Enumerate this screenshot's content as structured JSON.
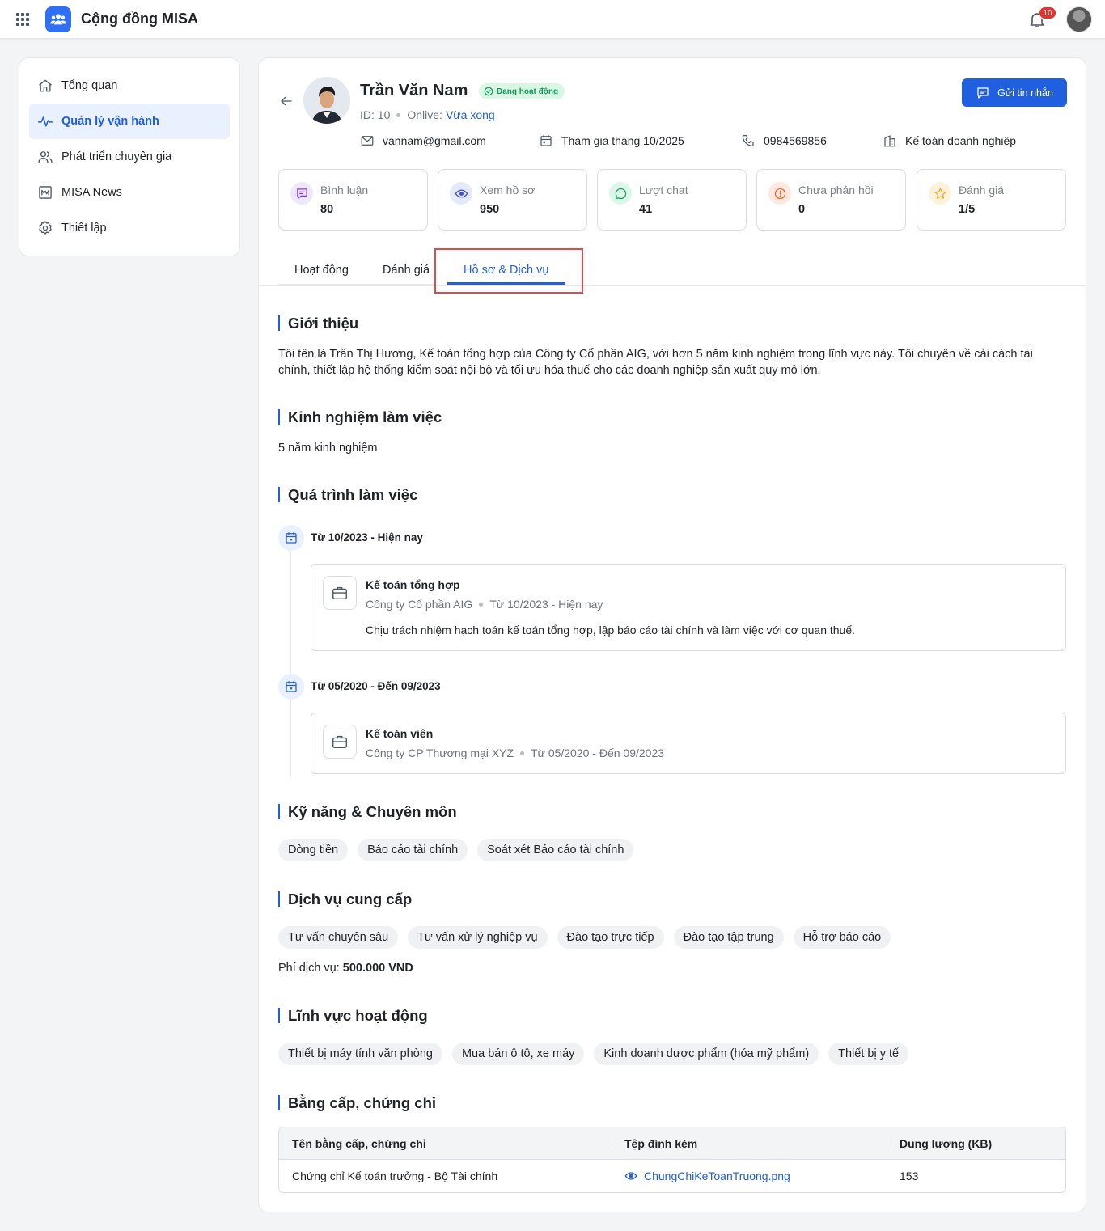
{
  "app": {
    "title": "Cộng đồng MISA",
    "notification_count": "10"
  },
  "sidebar": {
    "items": [
      {
        "label": "Tổng quan",
        "icon": "home-icon"
      },
      {
        "label": "Quản lý vận hành",
        "icon": "activity-icon",
        "active": true
      },
      {
        "label": "Phát triển chuyên gia",
        "icon": "users-icon"
      },
      {
        "label": "MISA News",
        "icon": "news-icon"
      },
      {
        "label": "Thiết lập",
        "icon": "gear-icon"
      }
    ]
  },
  "profile": {
    "name": "Trần Văn Nam",
    "status": "Đang hoạt động",
    "id_label": "ID: 10",
    "online_label": "Onlive:",
    "online_value": "Vừa xong",
    "email": "vannam@gmail.com",
    "joined": "Tham gia tháng 10/2025",
    "phone": "0984569856",
    "role": "Kế toán doanh nghiệp",
    "send_message_label": "Gửi tin nhắn"
  },
  "stats": [
    {
      "label": "Bình luận",
      "value": "80",
      "icon": "comment-icon",
      "color": "#7c3aed"
    },
    {
      "label": "Xem hồ sơ",
      "value": "950",
      "icon": "eye-icon",
      "color": "#3b4fd8"
    },
    {
      "label": "Lượt chat",
      "value": "41",
      "icon": "chat-icon",
      "color": "#16a36a"
    },
    {
      "label": "Chưa phản hồi",
      "value": "0",
      "icon": "alert-icon",
      "color": "#f26522"
    },
    {
      "label": "Đánh giá",
      "value": "1/5",
      "icon": "star-icon",
      "color": "#f5a623"
    }
  ],
  "tabs": [
    {
      "label": "Hoạt động"
    },
    {
      "label": "Đánh giá"
    },
    {
      "label": "Hồ sơ & Dịch vụ",
      "active": true
    }
  ],
  "sections": {
    "intro_title": "Giới thiệu",
    "intro_text": "Tôi tên là Trần Thị Hương, Kế toán tổng hợp của Công ty Cổ phần AIG, với hơn 5 năm kinh nghiệm trong lĩnh vực này. Tôi chuyên về cải cách tài chính, thiết lập hệ thống kiểm soát nội bộ và tối ưu hóa thuế cho các doanh nghiệp sản xuất quy mô lớn.",
    "exp_title": "Kinh nghiệm làm việc",
    "exp_text": "5 năm kinh nghiệm",
    "work_title": "Quá trình làm việc",
    "skills_title": "Kỹ năng & Chuyên môn",
    "services_title": "Dịch vụ cung cấp",
    "fee_label": "Phí dịch vụ:",
    "fee_value": "500.000 VND",
    "fields_title": "Lĩnh vực hoạt động",
    "certs_title": "Bằng cấp, chứng chỉ"
  },
  "timeline": [
    {
      "period": "Từ 10/2023 - Hiện nay",
      "title": "Kế toán tổng hợp",
      "company": "Công ty Cổ phần AIG",
      "range": "Từ 10/2023 - Hiện nay",
      "desc": "Chịu trách nhiệm hạch toán kế toán tổng hợp, lập báo cáo tài chính và làm việc với cơ quan thuế."
    },
    {
      "period": "Từ 05/2020 - Đến 09/2023",
      "title": "Kế toán viên",
      "company": "Công ty CP Thương mại XYZ",
      "range": "Từ 05/2020 - Đến 09/2023"
    }
  ],
  "skills": [
    "Dòng tiền",
    "Báo cáo tài chính",
    "Soát xét Báo cáo tài chính"
  ],
  "services": [
    "Tư vấn chuyên sâu",
    "Tư vấn xử lý nghiệp vụ",
    "Đào tạo trực tiếp",
    "Đào tạo tập trung",
    "Hỗ trợ báo cáo"
  ],
  "fields": [
    "Thiết bị máy tính văn phòng",
    "Mua bán ô tô, xe máy",
    "Kinh doanh dược phẩm (hóa mỹ phẩm)",
    "Thiết bị y tế"
  ],
  "certs": {
    "headers": [
      "Tên bằng cấp, chứng chỉ",
      "Tệp đính kèm",
      "Dung lượng (KB)"
    ],
    "rows": [
      {
        "name": "Chứng chỉ Kế toán trưởng - Bộ Tài chính",
        "file": "ChungChiKeToanTruong.png",
        "size": "153"
      }
    ]
  }
}
